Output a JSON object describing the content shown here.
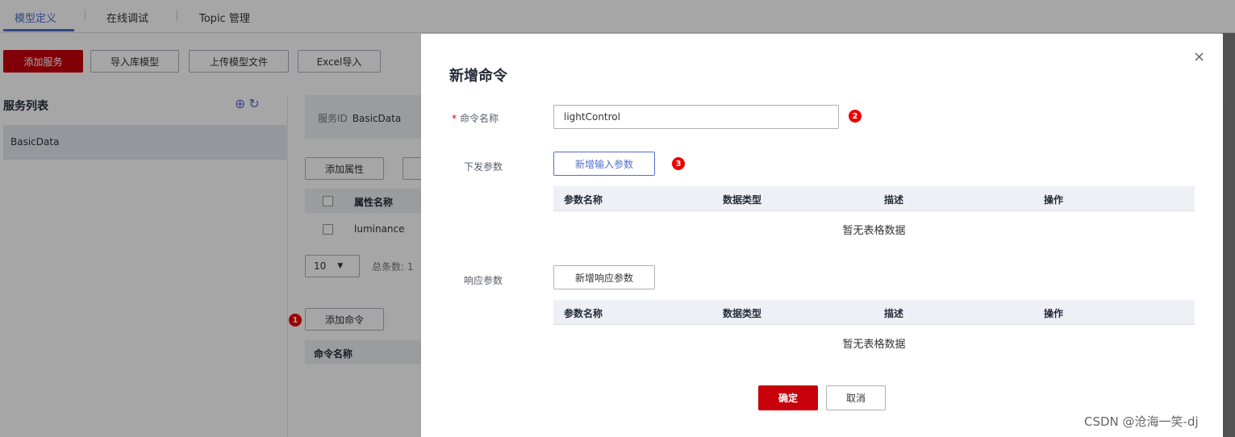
{
  "tabs": [
    "模型定义",
    "在线调试",
    "Topic 管理"
  ],
  "toolbar": {
    "add_service": "添加服务",
    "import_library": "导入库模型",
    "upload_model": "上传模型文件",
    "excel_import": "Excel导入"
  },
  "service_list": {
    "title": "服务列表",
    "icons": [
      "add-circle-icon",
      "refresh-icon"
    ],
    "items": [
      "BasicData"
    ]
  },
  "service_detail": {
    "id_label": "服务ID",
    "id_value": "BasicData",
    "add_property": "添加属性",
    "property_column": "属性名称",
    "property_rows": [
      "luminance"
    ],
    "page_size": "10",
    "total_label": "总条数: 1",
    "add_command": "添加命令",
    "command_column": "命令名称"
  },
  "badges": [
    "1",
    "2",
    "3"
  ],
  "dialog": {
    "title": "新增命令",
    "close_symbol": "×",
    "command_name_label": "命令名称",
    "command_name_value": "lightControl",
    "down_params_label": "下发参数",
    "add_input_param": "新增输入参数",
    "response_params_label": "响应参数",
    "add_response_param": "新增响应参数",
    "columns": [
      "参数名称",
      "数据类型",
      "描述",
      "操作"
    ],
    "empty_text": "暂无表格数据",
    "confirm": "确定",
    "cancel": "取消"
  },
  "watermark": "CSDN @沧海一笑-dj",
  "colors": {
    "accent_red": "#c7000b",
    "accent_blue": "#526ecc",
    "badge_red": "#ee0000"
  }
}
